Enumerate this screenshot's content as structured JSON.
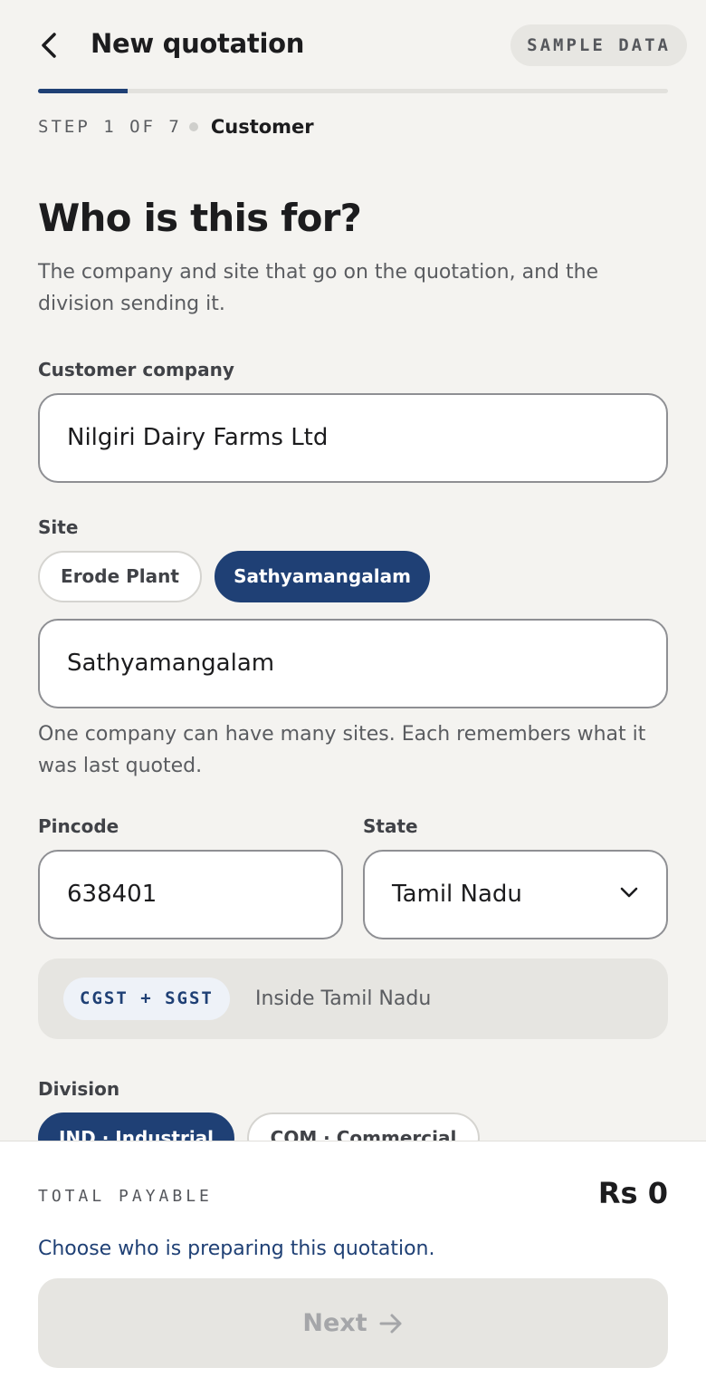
{
  "header": {
    "title": "New quotation",
    "badge": "SAMPLE DATA"
  },
  "progress": {
    "step_text": "STEP 1 OF 7",
    "step_name": "Customer",
    "fraction": 0.1429
  },
  "intro": {
    "heading": "Who is this for?",
    "subtitle": "The company and site that go on the quotation, and the division sending it."
  },
  "customer": {
    "label": "Customer company",
    "value": "Nilgiri Dairy Farms Ltd"
  },
  "site": {
    "label": "Site",
    "chips": [
      "Erode Plant",
      "Sathyamangalam"
    ],
    "selected": "Sathyamangalam",
    "value": "Sathyamangalam",
    "helper": "One company can have many sites. Each remembers what it was last quoted."
  },
  "pincode": {
    "label": "Pincode",
    "value": "638401"
  },
  "state": {
    "label": "State",
    "value": "Tamil Nadu"
  },
  "tax": {
    "badge": "CGST + SGST",
    "note": "Inside Tamil Nadu"
  },
  "division": {
    "label": "Division",
    "chips": [
      "IND · Industrial",
      "COM · Commercial"
    ],
    "selected": "IND · Industrial"
  },
  "footer": {
    "total_label": "TOTAL PAYABLE",
    "total_value": "Rs 0",
    "hint": "Choose who is preparing this quotation.",
    "next_label": "Next"
  },
  "colors": {
    "accent": "#1f4075",
    "background": "#f4f3f0"
  }
}
